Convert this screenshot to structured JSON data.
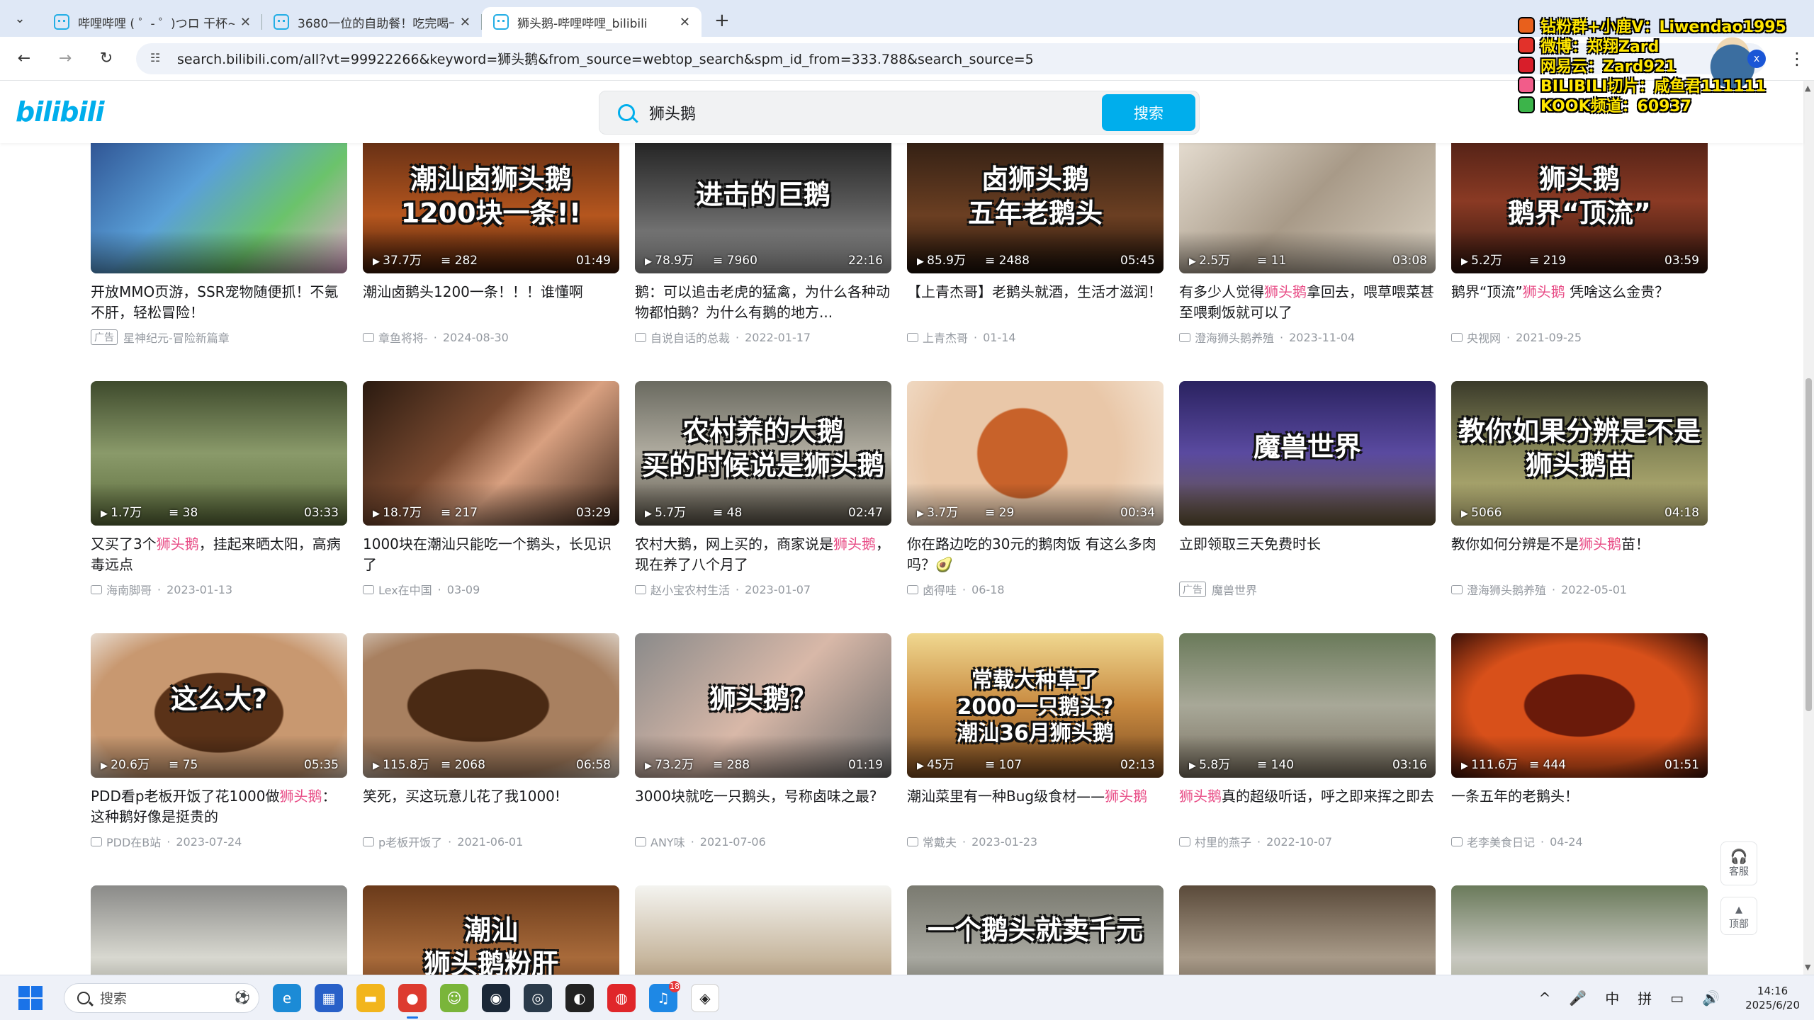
{
  "browser": {
    "tabs": [
      {
        "title": "哔哩哔哩 ( ゜- ゜)つロ 干杯~-b",
        "active": false
      },
      {
        "title": "3680一位的自助餐！吃完喝一",
        "active": false
      },
      {
        "title": "狮头鹅-哔哩哔哩_bilibili",
        "active": true
      }
    ],
    "url": "search.bilibili.com/all?vt=99922266&keyword=狮头鹅&from_source=webtop_search&spm_id_from=333.788&search_source=5"
  },
  "header": {
    "logo": "bilibili",
    "search_value": "狮头鹅",
    "search_button": "搜索"
  },
  "overlay": {
    "lines": [
      "钻粉群+小鹿V：Liwendao1995",
      "微博：郑翔Zard",
      "网易云：Zard921",
      "BILIBILI切片：咸鱼君111111",
      "KOOK频道：60937"
    ],
    "avatar_badge": "x"
  },
  "videos": [
    {
      "row": 0,
      "col": 0,
      "cover": "",
      "plays": "",
      "danmu": "",
      "duration": "",
      "title": [
        {
          "t": "开放MMO页游，SSR宠物随便抓！不氪不肝，轻松冒险！"
        }
      ],
      "ad": "广告",
      "up": "星神纪元-冒险新篇章",
      "date": "",
      "bg": "linear-gradient(135deg,#2c4f8f,#5aa0d8 40%,#6bc36b 70%,#e6a9d0)"
    },
    {
      "row": 0,
      "col": 1,
      "cover": "潮汕卤狮头鹅\n1200块一条!!",
      "plays": "37.7万",
      "danmu": "282",
      "duration": "01:49",
      "title": [
        {
          "t": "潮汕卤鹅头1200一条！！！谁懂啊"
        }
      ],
      "ad": "",
      "up": "章鱼将将-",
      "date": "2024-08-30",
      "bg": "linear-gradient(180deg,#5a2a14,#b5561e 60%,#3a1808)"
    },
    {
      "row": 0,
      "col": 2,
      "cover": "进击的巨鹅",
      "plays": "78.9万",
      "danmu": "7960",
      "duration": "22:16",
      "title": [
        {
          "t": "鹅：可以追击老虎的猛禽，为什么各种动物都怕鹅？为什么有鹅的地方..."
        }
      ],
      "ad": "",
      "up": "自说自话的总裁",
      "date": "2022-01-17",
      "bg": "linear-gradient(180deg,#1a1a1a,#555 50%,#9a9a9a)"
    },
    {
      "row": 0,
      "col": 3,
      "cover": "卤狮头鹅\n五年老鹅头",
      "plays": "85.9万",
      "danmu": "2488",
      "duration": "05:45",
      "title": [
        {
          "t": "【上青杰哥】老鹅头就酒，生活才滋润！"
        }
      ],
      "ad": "",
      "up": "上青杰哥",
      "date": "01-14",
      "bg": "linear-gradient(180deg,#2a1b12,#6b3f22 60%,#1a0f08)"
    },
    {
      "row": 0,
      "col": 4,
      "cover": "",
      "plays": "2.5万",
      "danmu": "11",
      "duration": "03:08",
      "title": [
        {
          "t": "有多少人觉得"
        },
        {
          "t": "狮头鹅",
          "kw": true
        },
        {
          "t": "拿回去，喂草喂菜甚至喂剩饭就可以了"
        }
      ],
      "ad": "",
      "up": "澄海狮头鹅养殖",
      "date": "2023-11-04",
      "bg": "linear-gradient(135deg,#e8e0d4,#a89a88 50%,#d8cfc0)"
    },
    {
      "row": 0,
      "col": 5,
      "cover": "狮头鹅\n鹅界“顶流”",
      "plays": "5.2万",
      "danmu": "219",
      "duration": "03:59",
      "title": [
        {
          "t": "鹅界“顶流”"
        },
        {
          "t": "狮头鹅",
          "kw": true
        },
        {
          "t": " 凭啥这么金贵？"
        }
      ],
      "ad": "",
      "up": "央视网",
      "date": "2021-09-25",
      "bg": "linear-gradient(180deg,#4a1e14,#8a3a24 50%,#2a120c)"
    },
    {
      "row": 1,
      "col": 0,
      "cover": "",
      "plays": "1.7万",
      "danmu": "38",
      "duration": "03:33",
      "title": [
        {
          "t": "又买了3个"
        },
        {
          "t": "狮头鹅",
          "kw": true
        },
        {
          "t": "，挂起来晒太阳，高病毒远点"
        }
      ],
      "ad": "",
      "up": "海南脚哥",
      "date": "2023-01-13",
      "bg": "linear-gradient(180deg,#3e4a2c,#8a9a6a 50%,#5a6a3a)"
    },
    {
      "row": 1,
      "col": 1,
      "cover": "",
      "plays": "18.7万",
      "danmu": "217",
      "duration": "03:29",
      "title": [
        {
          "t": "1000块在潮汕只能吃一个鹅头，长见识了"
        }
      ],
      "ad": "",
      "up": "Lex在中国",
      "date": "03-09",
      "bg": "linear-gradient(135deg,#2a1a10,#7a4a30 40%,#d8a080 60%,#3a2418)"
    },
    {
      "row": 1,
      "col": 2,
      "cover": "农村养的大鹅\n买的时候说是狮头鹅",
      "plays": "5.7万",
      "danmu": "48",
      "duration": "02:47",
      "title": [
        {
          "t": "农村大鹅，网上买的，商家说是"
        },
        {
          "t": "狮头鹅",
          "kw": true
        },
        {
          "t": "，现在养了八个月了"
        }
      ],
      "ad": "",
      "up": "赵小宝农村生活",
      "date": "2023-01-07",
      "bg": "linear-gradient(180deg,#6a6a60,#b0aca0 50%,#5a5448)"
    },
    {
      "row": 1,
      "col": 3,
      "cover": "",
      "plays": "3.7万",
      "danmu": "29",
      "duration": "00:34",
      "title": [
        {
          "t": "你在路边吃的30元的鹅肉饭 有这么多肉吗？🥑"
        }
      ],
      "ad": "",
      "up": "卤得哇",
      "date": "06-18",
      "bg": "radial-gradient(circle at 45% 50%,#c8622a 0 28%,#e9c7a8 29% 60%,#f3e2d0)"
    },
    {
      "row": 1,
      "col": 4,
      "cover": "魔兽世界",
      "plays": "",
      "danmu": "",
      "duration": "",
      "title": [
        {
          "t": "立即领取三天免费时长"
        }
      ],
      "ad": "广告",
      "up": "魔兽世界",
      "date": "",
      "bg": "linear-gradient(180deg,#2a2260,#5a4aa0 50%,#6a5a3a)"
    },
    {
      "row": 1,
      "col": 5,
      "cover": "教你如果分辨是不是\n狮头鹅苗",
      "plays": "5066",
      "danmu": "",
      "duration": "04:18",
      "title": [
        {
          "t": "教你如何分辨是不是"
        },
        {
          "t": "狮头鹅",
          "kw": true
        },
        {
          "t": "苗！"
        }
      ],
      "ad": "",
      "up": "澄海狮头鹅养殖",
      "date": "2022-05-01",
      "bg": "linear-gradient(180deg,#3a3a2a,#8a8a5a 50%,#c8c080)"
    },
    {
      "row": 2,
      "col": 0,
      "cover": "这么大?",
      "plays": "20.6万",
      "danmu": "75",
      "duration": "05:35",
      "title": [
        {
          "t": "PDD看p老板开饭了花1000做"
        },
        {
          "t": "狮头鹅",
          "kw": true
        },
        {
          "t": "：这种鹅好像是挺贵的"
        }
      ],
      "ad": "",
      "up": "PDD在B站",
      "date": "2023-07-24",
      "bg": "radial-gradient(ellipse at 50% 55%,#5a3218 0 35%,#c89870 36% 70%,#e8dcd0)"
    },
    {
      "row": 2,
      "col": 1,
      "cover": "",
      "plays": "115.8万",
      "danmu": "2068",
      "duration": "06:58",
      "title": [
        {
          "t": "笑死，买这玩意儿花了我1000!"
        }
      ],
      "ad": "",
      "up": "p老板开饭了",
      "date": "2021-06-01",
      "bg": "radial-gradient(ellipse at 45% 50%,#4a2a14 0 35%,#a88060 36% 70%,#d8ccc0)"
    },
    {
      "row": 2,
      "col": 2,
      "cover": "狮头鹅？",
      "plays": "73.2万",
      "danmu": "288",
      "duration": "01:19",
      "title": [
        {
          "t": "3000块就吃一只鹅头，号称卤味之最?"
        }
      ],
      "ad": "",
      "up": "ANY味",
      "date": "2021-07-06",
      "bg": "linear-gradient(135deg,#8a8a8a,#d8b8a8 50%,#6a6a6a)"
    },
    {
      "row": 2,
      "col": 3,
      "cover": "常载大种草了\n2000一只鹅头?\n潮汕36月狮头鹅",
      "plays": "45万",
      "danmu": "107",
      "duration": "02:13",
      "title": [
        {
          "t": "潮汕菜里有一种Bug级食材——"
        },
        {
          "t": "狮头鹅",
          "kw": true
        }
      ],
      "ad": "",
      "up": "常戴夫",
      "date": "2023-01-23",
      "bg": "linear-gradient(180deg,#f0d890,#c88a40 50%,#7a4a20)"
    },
    {
      "row": 2,
      "col": 4,
      "cover": "",
      "plays": "5.8万",
      "danmu": "140",
      "duration": "03:16",
      "title": [
        {
          "t": "狮头鹅",
          "kw": true
        },
        {
          "t": "真的超级听话，呼之即来挥之即去"
        }
      ],
      "ad": "",
      "up": "村里的燕子",
      "date": "2022-10-07",
      "bg": "linear-gradient(180deg,#6a7a5a,#a8a898 50%,#7a7060)"
    },
    {
      "row": 2,
      "col": 5,
      "cover": "",
      "plays": "111.6万",
      "danmu": "444",
      "duration": "01:51",
      "title": [
        {
          "t": "一条五年的老鹅头！"
        }
      ],
      "ad": "",
      "up": "老李美食日记",
      "date": "04-24",
      "bg": "radial-gradient(ellipse at 50% 50%,#6a1a0a 0 30%,#d8501a 31% 60%,#3a1008)"
    },
    {
      "row": 3,
      "col": 0,
      "cover": "",
      "plays": "",
      "danmu": "",
      "duration": "",
      "title": [],
      "ad": "",
      "up": "",
      "date": "",
      "bg": "linear-gradient(180deg,#8a8a88,#d8d8d0 50%,#6a6a60)"
    },
    {
      "row": 3,
      "col": 1,
      "cover": "潮汕\n狮头鹅粉肝",
      "plays": "",
      "danmu": "",
      "duration": "",
      "title": [],
      "ad": "",
      "up": "",
      "date": "",
      "bg": "linear-gradient(180deg,#6a3a1a,#a86a3a 50%,#3a1a0a)"
    },
    {
      "row": 3,
      "col": 2,
      "cover": "",
      "plays": "",
      "danmu": "",
      "duration": "",
      "title": [],
      "ad": "",
      "up": "",
      "date": "",
      "bg": "linear-gradient(180deg,#f4f4f0,#c8b8a0 50%,#7a5a3a)"
    },
    {
      "row": 3,
      "col": 3,
      "cover": "一个鹅头就卖千元",
      "plays": "",
      "danmu": "",
      "duration": "",
      "title": [],
      "ad": "",
      "up": "",
      "date": "",
      "bg": "linear-gradient(180deg,#7a7a70,#a8a8a0 50%,#3a3a30)"
    },
    {
      "row": 3,
      "col": 4,
      "cover": "",
      "plays": "",
      "danmu": "",
      "duration": "",
      "title": [],
      "ad": "",
      "up": "",
      "date": "",
      "bg": "linear-gradient(180deg,#5a4a3a,#a89a88 50%,#3a3028)"
    },
    {
      "row": 3,
      "col": 5,
      "cover": "",
      "plays": "",
      "danmu": "",
      "duration": "",
      "title": [],
      "ad": "",
      "up": "",
      "date": "",
      "bg": "linear-gradient(180deg,#6a7a5a,#c8c8c0 50%,#8a9070)"
    }
  ],
  "float_buttons": {
    "service": "客服",
    "top": "顶部"
  },
  "taskbar": {
    "search_placeholder": "搜索",
    "apps": [
      {
        "name": "edge",
        "color": "#1c8bd6",
        "glyph": "e"
      },
      {
        "name": "store",
        "color": "#2860c8",
        "glyph": "▦"
      },
      {
        "name": "explorer",
        "color": "#f2b51c",
        "glyph": "▬"
      },
      {
        "name": "chrome",
        "color": "#dd3b2f",
        "glyph": "●"
      },
      {
        "name": "frog",
        "color": "#7ab53a",
        "glyph": "☺"
      },
      {
        "name": "steam",
        "color": "#1b2838",
        "glyph": "◉"
      },
      {
        "name": "client",
        "color": "#2a3a4a",
        "glyph": "◎"
      },
      {
        "name": "obs",
        "color": "#222",
        "glyph": "◐"
      },
      {
        "name": "netease",
        "color": "#e0262a",
        "glyph": "◍"
      },
      {
        "name": "qq",
        "color": "#1e88e5",
        "glyph": "♫",
        "badge": "18"
      },
      {
        "name": "unity",
        "color": "#fff",
        "glyph": "◈"
      }
    ],
    "tray": [
      "^",
      "🎤",
      "中",
      "拼",
      "▭",
      "🔊"
    ],
    "time": "14:16",
    "date": "2025/6/20"
  }
}
